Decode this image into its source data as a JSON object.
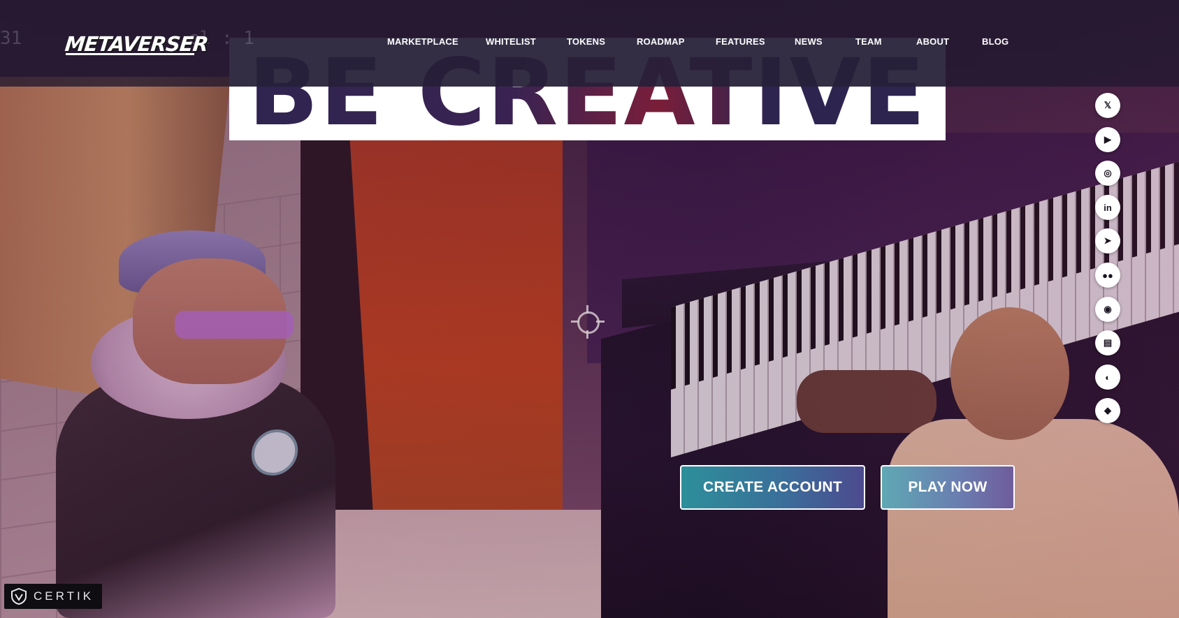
{
  "hud": {
    "counter": "31",
    "level": "el : 1"
  },
  "brand": {
    "logo_text": "METAVERSER"
  },
  "nav": {
    "items": [
      {
        "label": "MARKETPLACE"
      },
      {
        "label": "WHITELIST"
      },
      {
        "label": "TOKENS"
      },
      {
        "label": "ROADMAP"
      },
      {
        "label": "FEATURES"
      },
      {
        "label": "NEWS"
      },
      {
        "label": "TEAM"
      },
      {
        "label": "ABOUT"
      },
      {
        "label": "BLOG"
      }
    ]
  },
  "hero": {
    "headline": "BE CREATIVE"
  },
  "social": {
    "items": [
      {
        "name": "x-twitter-icon",
        "glyph": "𝕏"
      },
      {
        "name": "youtube-icon",
        "glyph": "▶"
      },
      {
        "name": "instagram-icon",
        "glyph": "◎"
      },
      {
        "name": "linkedin-icon",
        "glyph": "in"
      },
      {
        "name": "telegram-icon",
        "glyph": "➤"
      },
      {
        "name": "medium-icon",
        "glyph": "●●"
      },
      {
        "name": "github-icon",
        "glyph": "◉"
      },
      {
        "name": "substack-icon",
        "glyph": "▤"
      },
      {
        "name": "coingecko-icon",
        "glyph": "◐"
      },
      {
        "name": "academy-cap-icon",
        "glyph": "◆"
      }
    ]
  },
  "cta": {
    "create_account": "CREATE ACCOUNT",
    "play_now": "PLAY NOW"
  },
  "badge": {
    "certik": "CERTIK"
  }
}
